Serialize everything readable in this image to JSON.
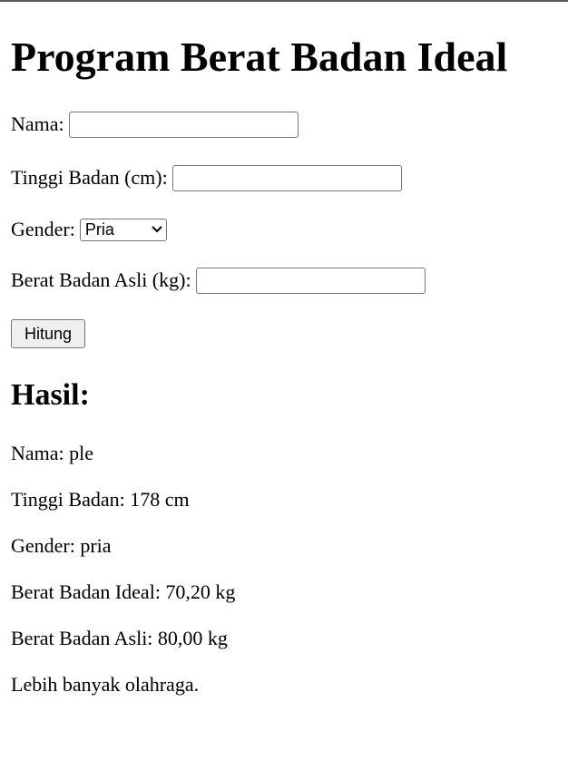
{
  "page": {
    "title": "Program Berat Badan Ideal"
  },
  "form": {
    "nama_label": "Nama:",
    "nama_value": "",
    "tinggi_label": "Tinggi Badan (cm):",
    "tinggi_value": "",
    "gender_label": "Gender:",
    "gender_selected": "Pria",
    "berat_label": "Berat Badan Asli (kg):",
    "berat_value": "",
    "submit_label": "Hitung"
  },
  "result": {
    "heading": "Hasil:",
    "nama": "Nama: ple",
    "tinggi": "Tinggi Badan: 178 cm",
    "gender": "Gender: pria",
    "ideal": "Berat Badan Ideal: 70,20 kg",
    "asli": "Berat Badan Asli: 80,00 kg",
    "advice": "Lebih banyak olahraga."
  },
  "icons": {
    "gender_select": "chevron-down-icon"
  }
}
